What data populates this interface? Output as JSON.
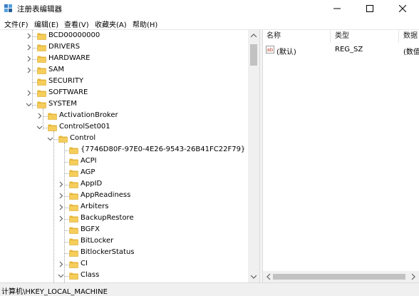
{
  "window": {
    "title": "注册表编辑器",
    "minimize_glyph": "—",
    "maximize_glyph": "☐",
    "close_glyph": "✕"
  },
  "menu": [
    {
      "label": "文件(F)"
    },
    {
      "label": "编辑(E)"
    },
    {
      "label": "查看(V)"
    },
    {
      "label": "收藏夹(A)"
    },
    {
      "label": "帮助(H)"
    }
  ],
  "tree": [
    {
      "label": "BCD00000000",
      "expander": "collapsed"
    },
    {
      "label": "DRIVERS",
      "expander": "collapsed"
    },
    {
      "label": "HARDWARE",
      "expander": "collapsed"
    },
    {
      "label": "SAM",
      "expander": "collapsed"
    },
    {
      "label": "SECURITY",
      "expander": "none"
    },
    {
      "label": "SOFTWARE",
      "expander": "collapsed"
    },
    {
      "label": "SYSTEM",
      "expander": "expanded"
    },
    {
      "label": "ActivationBroker",
      "expander": "collapsed"
    },
    {
      "label": "ControlSet001",
      "expander": "expanded"
    },
    {
      "label": "Control",
      "expander": "expanded"
    },
    {
      "label": "{7746D80F-97E0-4E26-9543-26B41FC22F79}",
      "expander": "none"
    },
    {
      "label": "ACPI",
      "expander": "none"
    },
    {
      "label": "AGP",
      "expander": "none"
    },
    {
      "label": "AppID",
      "expander": "collapsed"
    },
    {
      "label": "AppReadiness",
      "expander": "collapsed"
    },
    {
      "label": "Arbiters",
      "expander": "collapsed"
    },
    {
      "label": "BackupRestore",
      "expander": "collapsed"
    },
    {
      "label": "BGFX",
      "expander": "none"
    },
    {
      "label": "BitLocker",
      "expander": "none"
    },
    {
      "label": "BitlockerStatus",
      "expander": "none"
    },
    {
      "label": "CI",
      "expander": "collapsed"
    },
    {
      "label": "Class",
      "expander": "expanded"
    }
  ],
  "values_list": {
    "columns": [
      "名称",
      "类型",
      "数据"
    ],
    "rows": [
      {
        "name": "(默认)",
        "type": "REG_SZ",
        "data": "(数值"
      }
    ],
    "icon_text": "ab",
    "icon_color": "#c0392b"
  },
  "status": {
    "path": "计算机\\HKEY_LOCAL_MACHINE"
  },
  "colors": {
    "folder": "#f5cd5a",
    "folder_tab": "#e9b83a"
  }
}
